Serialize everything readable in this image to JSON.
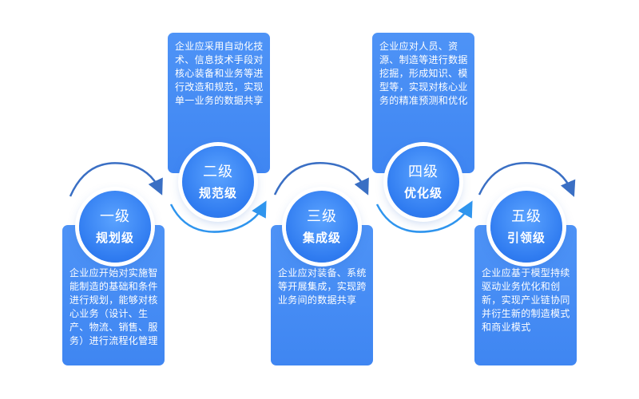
{
  "colors": {
    "card": "#4a8ff5",
    "circle": "#3a84f5",
    "arrow_dark": "#3a6fc4",
    "arrow_light": "#2f95ee"
  },
  "stages": [
    {
      "level": "一级",
      "name": "规划级",
      "desc": "企业应开始对实施智能制造的基础和条件进行规划，能够对核心业务（设计、生产、物流、销售、服务）进行流程化管理"
    },
    {
      "level": "二级",
      "name": "规范级",
      "desc": "企业应采用自动化技术、信息技术手段对核心装备和业务等进行改造和规范，实现单一业务的数据共享"
    },
    {
      "level": "三级",
      "name": "集成级",
      "desc": "企业应对装备、系统等开展集成，实现跨业务间的数据共享"
    },
    {
      "level": "四级",
      "name": "优化级",
      "desc": "企业应对人员、资源、制造等进行数据挖掘，形成知识、模型等，实现对核心业务的精准预测和优化"
    },
    {
      "level": "五级",
      "name": "引领级",
      "desc": "企业应基于模型持续驱动业务优化和创新，实现产业链协同并衍生新的制造模式和商业模式"
    }
  ]
}
